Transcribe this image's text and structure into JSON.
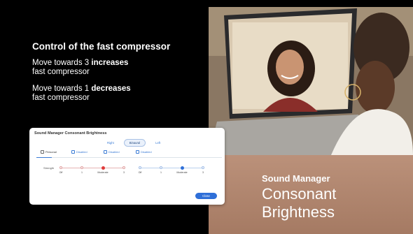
{
  "left": {
    "heading": "Control of the fast compressor",
    "p1_pre": "Move towards 3 ",
    "p1_bold": "increases",
    "p1_post": "fast compressor",
    "p2_pre": "Move towards 1 ",
    "p2_bold": "decreases",
    "p2_post": "fast compressor"
  },
  "caption": {
    "small": "Sound Manager",
    "line1": "Consonant",
    "line2": "Brightness"
  },
  "dialog": {
    "title": "Sound Manager Consonant Brightness",
    "segments": [
      "Right",
      "Binaural",
      "Left"
    ],
    "active_segment": "Binaural",
    "tabs": [
      "Personal",
      "Disabled",
      "Disabled",
      "Disabled"
    ],
    "strength_label": "Strength",
    "slider_left": {
      "labels": [
        "Off",
        "1",
        "Moderate",
        "3"
      ],
      "value": "Moderate",
      "color": "#e03a3a"
    },
    "slider_right": {
      "labels": [
        "Off",
        "1",
        "Moderate",
        "3"
      ],
      "value": "Moderate",
      "color": "#2f6fd8"
    },
    "close_label": "Close"
  }
}
